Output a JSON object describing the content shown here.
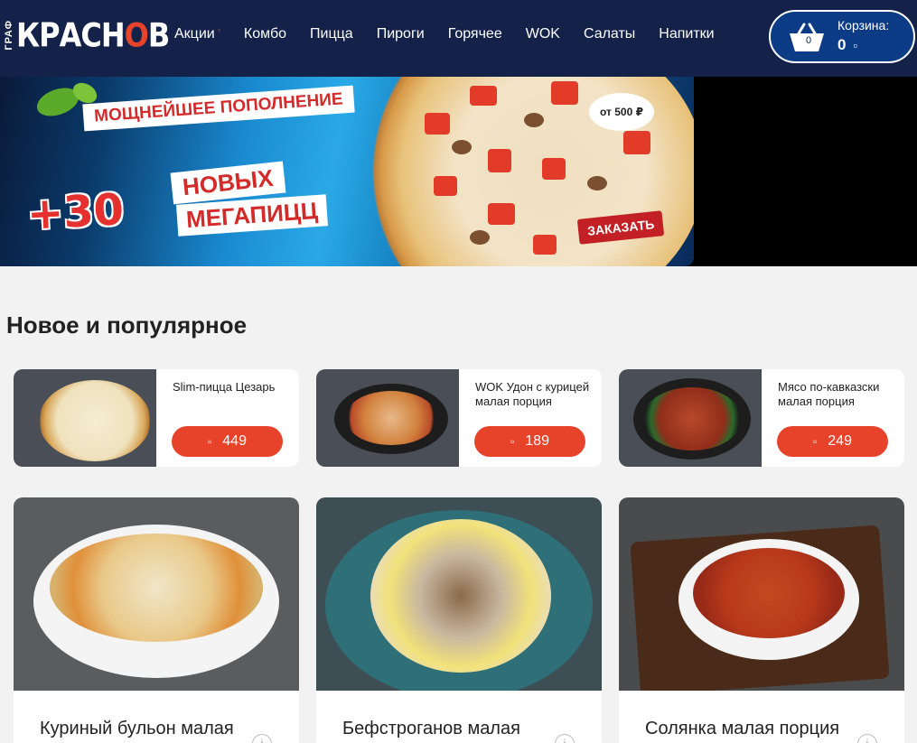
{
  "logo": {
    "small": "ГРАФ",
    "big_part1": "КРАСН",
    "big_o": "О",
    "big_part2": "В"
  },
  "nav": [
    {
      "label": "Акции",
      "badge": "▫"
    },
    {
      "label": "Комбо"
    },
    {
      "label": "Пицца"
    },
    {
      "label": "Пироги"
    },
    {
      "label": "Горячее"
    },
    {
      "label": "WOK"
    },
    {
      "label": "Салаты"
    },
    {
      "label": "Напитки"
    }
  ],
  "cart": {
    "label": "Корзина:",
    "count": "0",
    "sum": "0",
    "currency": "▫"
  },
  "banner": {
    "headline": "МОЩНЕЙШЕЕ ПОПОЛНЕНИЕ",
    "count": "+30",
    "line1": "НОВЫХ",
    "line2": "МЕГАПИЦЦ",
    "price_bubble": "от 500 ₽",
    "order_button": "ЗАКАЗАТЬ"
  },
  "section_title": "Новое и популярное",
  "small_cards": [
    {
      "name": "Slim-пицца Цезарь",
      "price": "449",
      "currency": "▫"
    },
    {
      "name": "WOK Удон с курицей малая порция",
      "price": "189",
      "currency": "▫"
    },
    {
      "name": "Мясо по-кавказски малая порция",
      "price": "249",
      "currency": "▫"
    }
  ],
  "large_cards": [
    {
      "name": "Куриный бульон малая",
      "info": "i"
    },
    {
      "name": "Бефстроганов малая",
      "info": "i"
    },
    {
      "name": "Солянка малая порция",
      "info": "i"
    }
  ]
}
